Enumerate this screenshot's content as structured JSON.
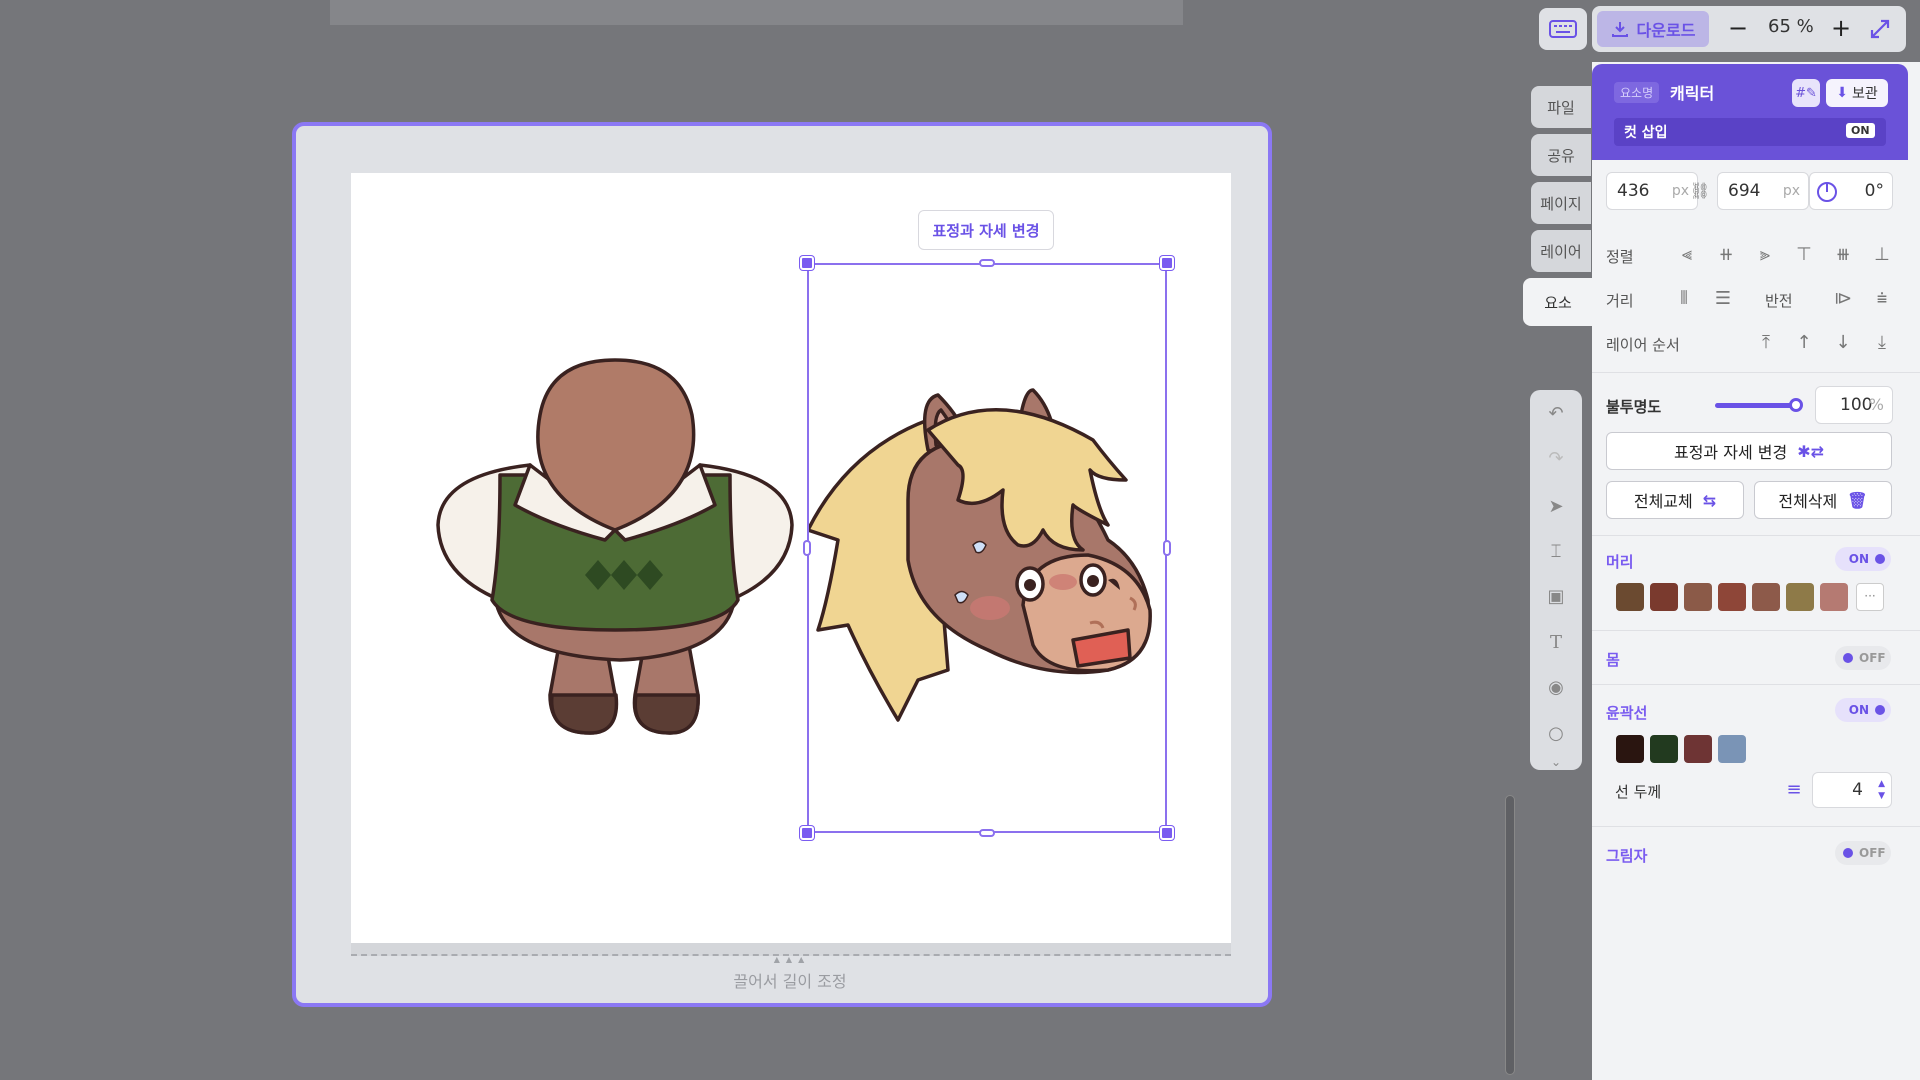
{
  "toolbar": {
    "download_label": "다운로드",
    "zoom_minus": "−",
    "zoom_value": "65 %",
    "zoom_plus": "+"
  },
  "side_tabs": [
    "파일",
    "공유",
    "페이지",
    "레이어",
    "요소"
  ],
  "canvas": {
    "float_button": "표정과 자세 변경",
    "resize_label": "끌어서 길이 조정"
  },
  "panel": {
    "tag": "요소명",
    "title": "캐릭터",
    "save_label": "보관",
    "cut_insert_label": "컷 삽입",
    "cut_insert_state": "ON",
    "width": "436",
    "height": "694",
    "unit": "px",
    "rotation": "0°",
    "align_label": "정렬",
    "distance_label": "거리",
    "flip_label": "반전",
    "layer_order_label": "레이어 순서",
    "opacity_label": "불투명도",
    "opacity_value": "100",
    "opacity_unit": "%",
    "change_pose_label": "표정과 자세 변경",
    "replace_all_label": "전체교체",
    "delete_all_label": "전체삭제",
    "sections": {
      "hair": {
        "title": "머리",
        "state": "ON"
      },
      "body": {
        "title": "몸",
        "state": "OFF"
      },
      "outline": {
        "title": "윤곽선",
        "state": "ON"
      },
      "shadow": {
        "title": "그림자",
        "state": "OFF"
      }
    },
    "hair_colors": [
      "#6b4a30",
      "#7a3a2e",
      "#8b5a48",
      "#8e4638",
      "#8d5a4a",
      "#8e7a48",
      "#b57a72"
    ],
    "outline_colors": [
      "#2a1510",
      "#223a1f",
      "#6e3434",
      "#7a94b6"
    ],
    "stroke_label": "선 두께",
    "stroke_value": "4"
  },
  "colors": {
    "accent": "#6a52e6",
    "frame": "#8b78f4"
  }
}
